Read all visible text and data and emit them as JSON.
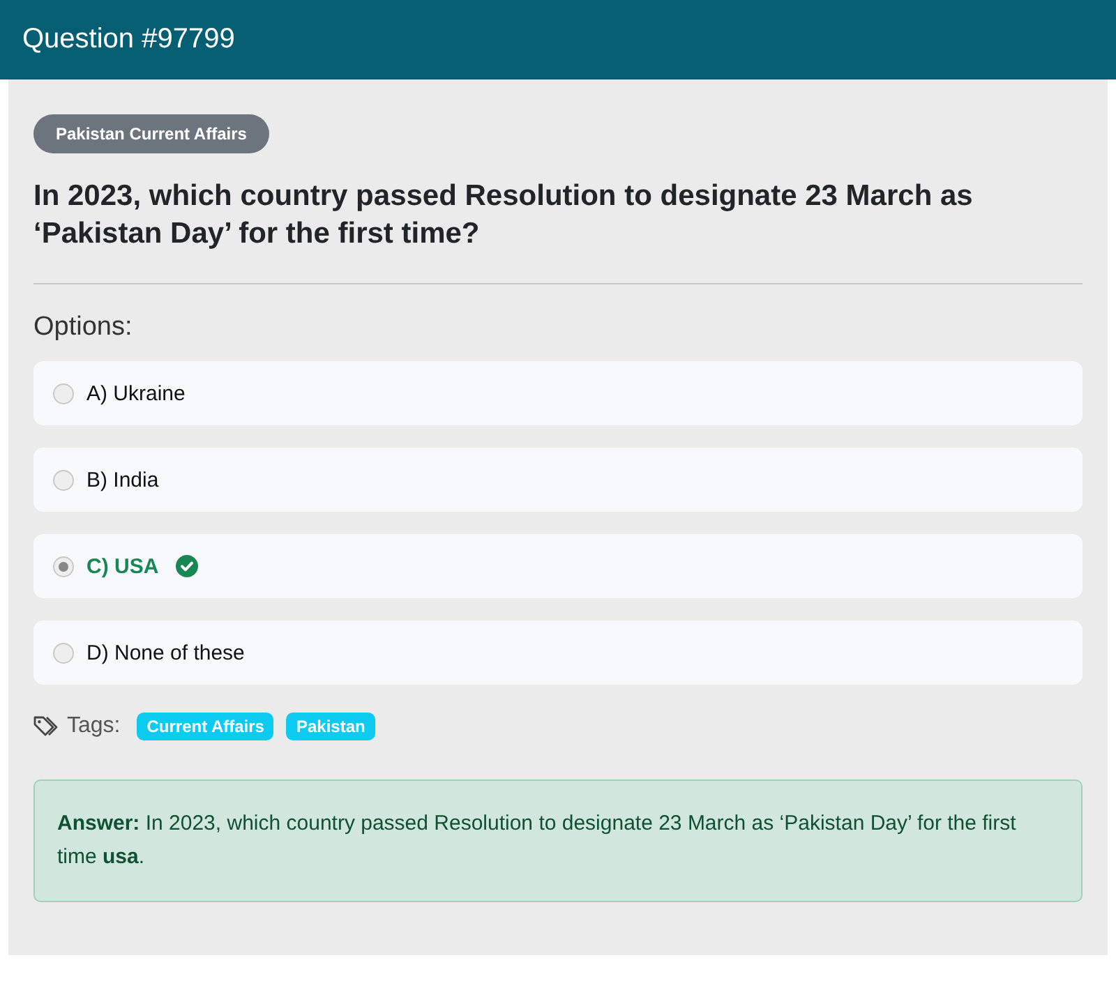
{
  "header": {
    "title": "Question #97799"
  },
  "category": "Pakistan Current Affairs",
  "question": "In 2023, which country passed Resolution to designate 23 March as ‘Pakistan Day’ for the first time?",
  "options_label": "Options:",
  "options": [
    {
      "text": "A) Ukraine",
      "selected": false,
      "correct": false
    },
    {
      "text": "B) India",
      "selected": false,
      "correct": false
    },
    {
      "text": "C) USA",
      "selected": true,
      "correct": true
    },
    {
      "text": "D) None of these",
      "selected": false,
      "correct": false
    }
  ],
  "tags_label": "Tags:",
  "tags": [
    "Current Affairs",
    "Pakistan"
  ],
  "answer": "**Answer:** In 2023, which country passed Resolution to designate 23 March as ‘Pakistan Day’ for the first time **usa**."
}
